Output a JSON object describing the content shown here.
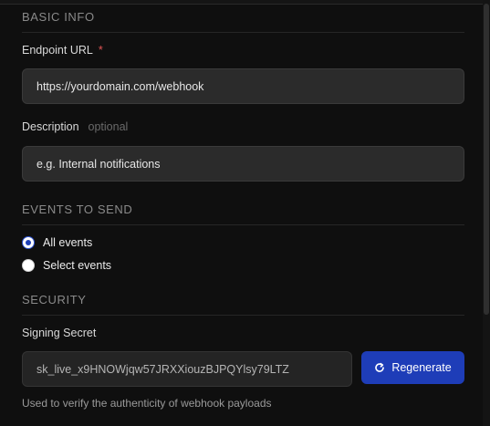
{
  "basic_info": {
    "section_title": "BASIC INFO",
    "endpoint_url": {
      "label": "Endpoint URL",
      "required_mark": "*",
      "placeholder": "https://yourdomain.com/webhook"
    },
    "description": {
      "label": "Description",
      "optional_tag": "optional",
      "placeholder": "e.g. Internal notifications"
    }
  },
  "events": {
    "section_title": "EVENTS TO SEND",
    "options": [
      {
        "label": "All events",
        "selected": true
      },
      {
        "label": "Select events",
        "selected": false
      }
    ]
  },
  "security": {
    "section_title": "SECURITY",
    "signing_secret_label": "Signing Secret",
    "signing_secret_value": "sk_live_x9HNOWjqw57JRXXiouzBJPQYlsy79LTZ",
    "regenerate_label": "Regenerate",
    "regenerate_icon": "refresh-icon",
    "help_text": "Used to verify the authenticity of webhook payloads"
  },
  "colors": {
    "background": "#0f0f0f",
    "input_bg": "#2b2b2b",
    "accent": "#1e3db8",
    "required": "#e05454",
    "section_title": "#8a8a8a"
  }
}
